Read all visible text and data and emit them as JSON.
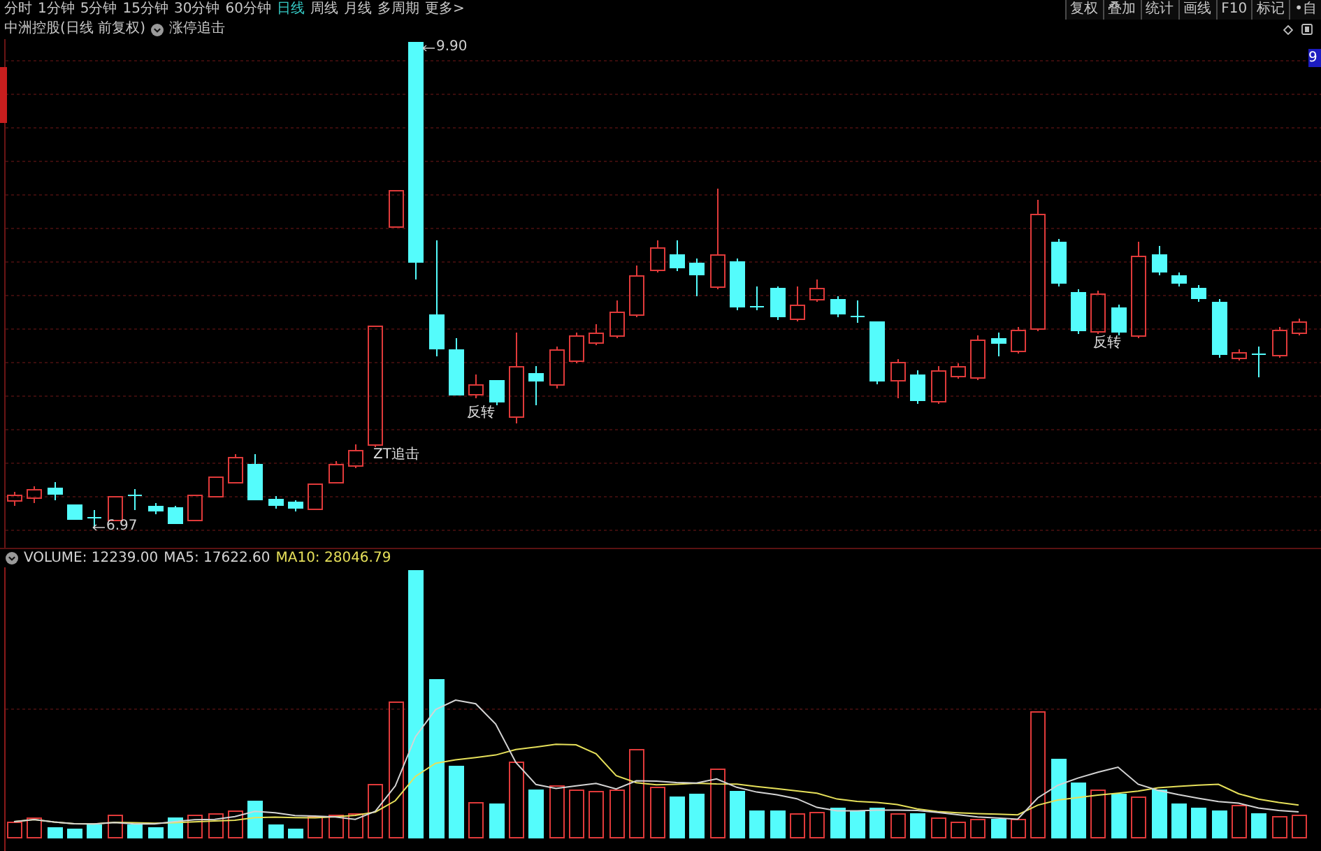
{
  "toolbar": {
    "periods": [
      {
        "label": "分时",
        "selected": false
      },
      {
        "label": "1分钟",
        "selected": false
      },
      {
        "label": "5分钟",
        "selected": false
      },
      {
        "label": "15分钟",
        "selected": false
      },
      {
        "label": "30分钟",
        "selected": false
      },
      {
        "label": "60分钟",
        "selected": false
      },
      {
        "label": "日线",
        "selected": true
      },
      {
        "label": "周线",
        "selected": false
      },
      {
        "label": "月线",
        "selected": false
      },
      {
        "label": "多周期",
        "selected": false
      },
      {
        "label": "更多>",
        "selected": false
      }
    ],
    "actions": [
      "复权",
      "叠加",
      "统计",
      "画线",
      "F10",
      "标记",
      "•自"
    ]
  },
  "chart_header": {
    "title": "中洲控股(日线 前复权)",
    "indicator": "涨停追击"
  },
  "price_chart": {
    "high_label": "9.90",
    "low_label": "6.97",
    "signals": [
      "ZT追击",
      "反转",
      "反转"
    ],
    "right_tag": "9"
  },
  "volume_panel": {
    "legend": [
      {
        "text": "VOLUME: 12239.00",
        "color": "#d4d4d4"
      },
      {
        "text": "MA5: 17622.60",
        "color": "#d4d4d4"
      },
      {
        "text": "MA10: 28046.79",
        "color": "#e6e05a"
      }
    ]
  }
}
